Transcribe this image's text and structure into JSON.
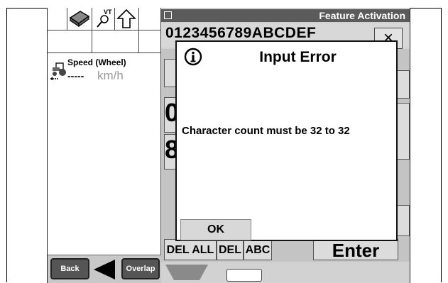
{
  "left_pane": {
    "speed_label": "Speed (Wheel)",
    "speed_value": "-----",
    "speed_unit": "km/h",
    "vt_label": "VT",
    "back_label": "Back",
    "overlap_label": "Overlap"
  },
  "feature_activation": {
    "title": "Feature Activation",
    "code_text": "0123456789ABCDEF",
    "close_glyph": "×",
    "keys": {
      "del_all": "DEL ALL",
      "del": "DEL",
      "abc": "ABC",
      "enter": "Enter",
      "partial_key_1": "0",
      "partial_key_2": "8"
    }
  },
  "dialog": {
    "title": "Input Error",
    "message": "Character count must be 32 to 32",
    "ok_label": "OK"
  },
  "colors": {
    "titlebar": "#5b5b5b",
    "panel": "#d2d2d2",
    "dialog_bg": "#ffffff"
  }
}
